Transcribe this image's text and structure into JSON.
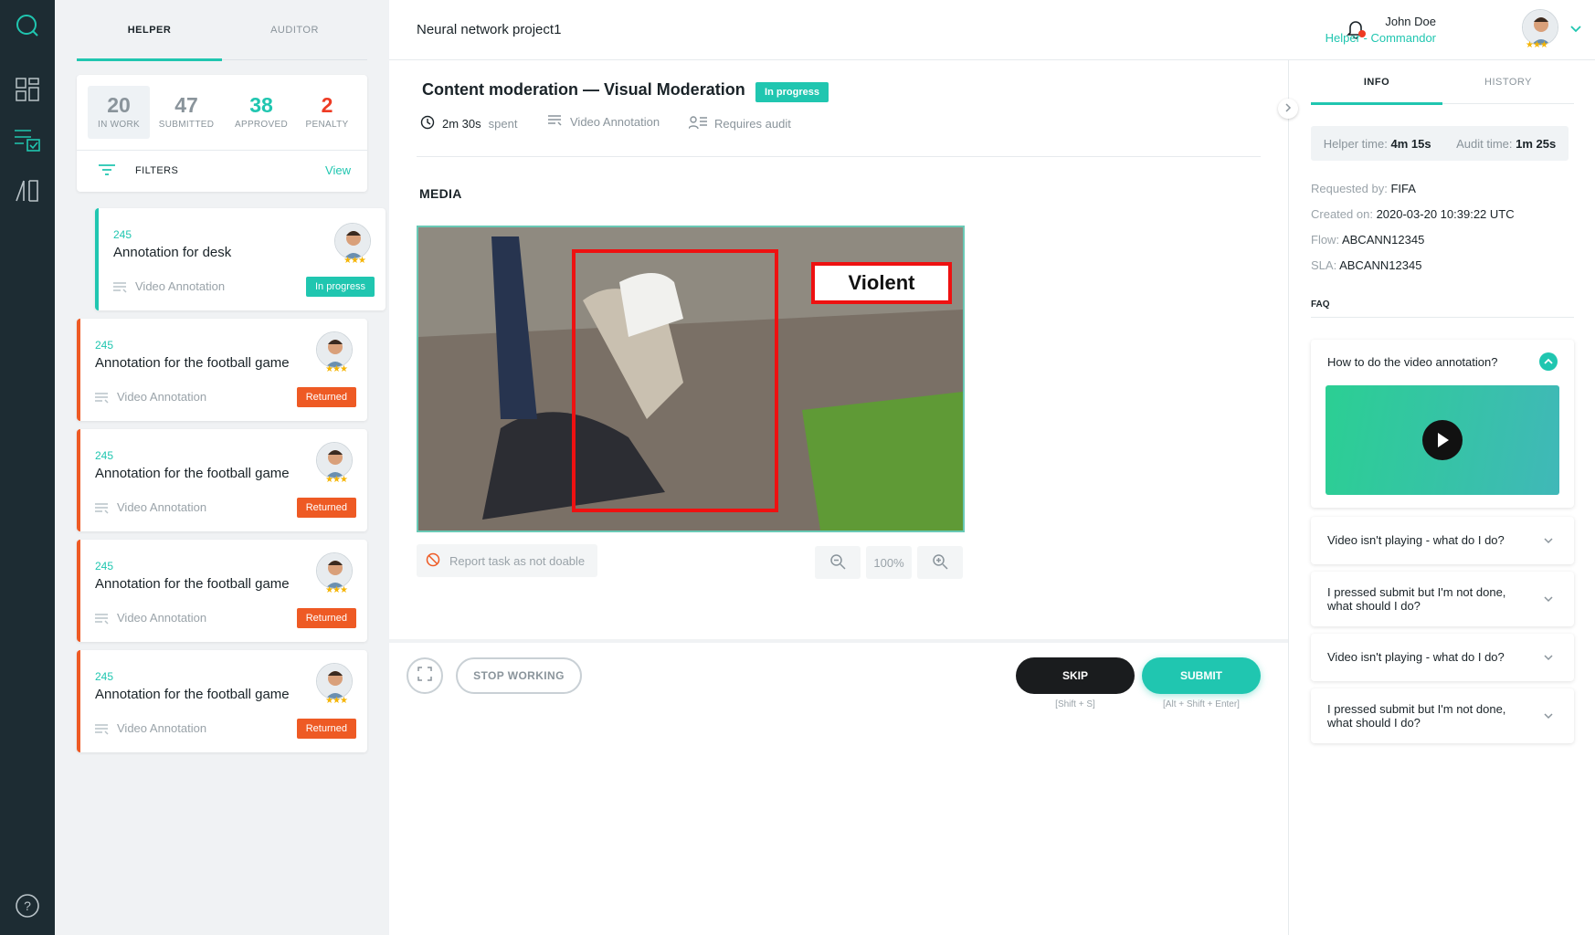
{
  "tasks_panel": {
    "tabs": [
      {
        "label": "HELPER",
        "active": true
      },
      {
        "label": "AUDITOR",
        "active": false
      }
    ],
    "stats": [
      {
        "value": "20",
        "label": "IN WORK",
        "color": "#8a949b"
      },
      {
        "value": "47",
        "label": "SUBMITTED",
        "color": "#8a949b"
      },
      {
        "value": "38",
        "label": "APPROVED",
        "color": "#20c6b0"
      },
      {
        "value": "2",
        "label": "PENALTY",
        "color": "#ee3b24"
      }
    ],
    "filters": {
      "label": "FILTERS",
      "link": "View"
    },
    "cards": [
      {
        "id": "245",
        "title": "Annotation for desk",
        "type": "Video Annotation",
        "status": "In progress",
        "status_color": "#20c6b0",
        "stars": "★★★"
      },
      {
        "id": "245",
        "title": "Annotation for the football game",
        "type": "Video Annotation",
        "status": "Returned",
        "status_color": "#ee5a24",
        "stars": "★★★"
      },
      {
        "id": "245",
        "title": "Annotation for the football game",
        "type": "Video Annotation",
        "status": "Returned",
        "status_color": "#ee5a24",
        "stars": "★★★"
      },
      {
        "id": "245",
        "title": "Annotation for the football game",
        "type": "Video Annotation",
        "status": "Returned",
        "status_color": "#ee5a24",
        "stars": "★★★"
      },
      {
        "id": "245",
        "title": "Annotation for the football game",
        "type": "Video Annotation",
        "status": "Returned",
        "status_color": "#ee5a24",
        "stars": "★★★"
      }
    ]
  },
  "header": {
    "project_title": "Neural network project1",
    "user_name": "John Doe",
    "user_role": "Helper - Commandor",
    "user_stars": "★★★"
  },
  "task": {
    "title": "Content moderation — Visual Moderation",
    "status": "In progress",
    "time_value": "2m 30s",
    "time_suffix": "spent",
    "type": "Video Annotation",
    "audit": "Requires audit",
    "media_label": "MEDIA",
    "annotation_label": "Violent",
    "report_label": "Report task as not doable",
    "zoom_level": "100%"
  },
  "actions": {
    "stop_label": "STOP WORKING",
    "skip_label": "SKIP",
    "skip_shortcut": "[Shift + S]",
    "submit_label": "SUBMIT",
    "submit_shortcut": "[Alt + Shift + Enter]"
  },
  "info_panel": {
    "tabs": [
      {
        "label": "INFO",
        "active": true
      },
      {
        "label": "HISTORY",
        "active": false
      }
    ],
    "helper_time_label": "Helper time:",
    "helper_time_value": "4m 15s",
    "audit_time_label": "Audit time:",
    "audit_time_value": "1m 25s",
    "details": [
      {
        "label": "Requested by:",
        "value": "FIFA"
      },
      {
        "label": "Created on:",
        "value": "2020-03-20 10:39:22 UTC"
      },
      {
        "label": "Flow:",
        "value": "ABCANN12345"
      },
      {
        "label": "SLA:",
        "value": "ABCANN12345"
      }
    ],
    "faq_title": "FAQ",
    "faqs": [
      {
        "question": "How to do the video annotation?",
        "expanded": true
      },
      {
        "question": "Video isn't playing - what do I do?",
        "expanded": false
      },
      {
        "question": "I pressed submit but I'm not done, what should I do?",
        "expanded": false
      },
      {
        "question": "Video isn't playing - what do I do?",
        "expanded": false
      },
      {
        "question": "I pressed submit but I'm not done, what should I do?",
        "expanded": false
      }
    ]
  },
  "colors": {
    "accent": "#20c6b0",
    "danger": "#ee5a24",
    "rail": "#1d2c33"
  }
}
